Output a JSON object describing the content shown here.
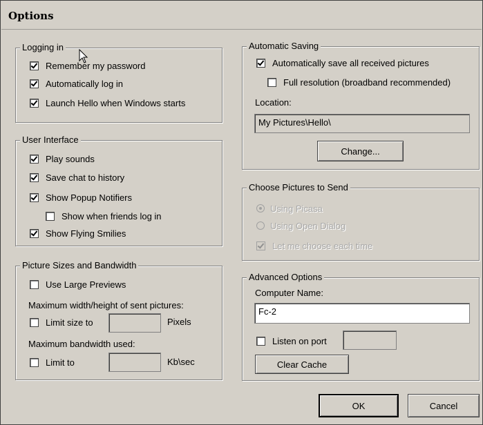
{
  "window": {
    "title": "Options"
  },
  "logging_in": {
    "legend": "Logging in",
    "remember_password": {
      "label": "Remember my password",
      "checked": true
    },
    "auto_login": {
      "label": "Automatically log in",
      "checked": true
    },
    "launch_on_start": {
      "label": "Launch Hello when Windows starts",
      "checked": true
    }
  },
  "user_interface": {
    "legend": "User Interface",
    "play_sounds": {
      "label": "Play sounds",
      "checked": true
    },
    "save_chat": {
      "label": "Save chat to history",
      "checked": true
    },
    "popup_notifiers": {
      "label": "Show Popup Notifiers",
      "checked": true
    },
    "friends_log_in": {
      "label": "Show when friends log in",
      "checked": false
    },
    "flying_smilies": {
      "label": "Show Flying Smilies",
      "checked": true
    }
  },
  "picture_sizes": {
    "legend": "Picture Sizes and Bandwidth",
    "large_previews": {
      "label": "Use Large Previews",
      "checked": false
    },
    "max_size_caption": "Maximum width/height of sent pictures:",
    "limit_size": {
      "label": "Limit size to",
      "checked": false,
      "value": "",
      "unit": "Pixels"
    },
    "max_bandwidth_caption": "Maximum bandwidth used:",
    "limit_bandwidth": {
      "label": "Limit to",
      "checked": false,
      "value": "",
      "unit": "Kb\\sec"
    }
  },
  "automatic_saving": {
    "legend": "Automatic Saving",
    "save_all": {
      "label": "Automatically save all received pictures",
      "checked": true
    },
    "full_resolution": {
      "label": "Full resolution (broadband recommended)",
      "checked": false
    },
    "location_label": "Location:",
    "location_value": "My Pictures\\Hello\\",
    "change_button": "Change..."
  },
  "choose_pictures": {
    "legend": "Choose Pictures to Send",
    "using_picasa": {
      "label": "Using Picasa",
      "selected": true
    },
    "using_open_dialog": {
      "label": "Using Open Dialog",
      "selected": false
    },
    "let_me_choose": {
      "label": "Let me choose each time",
      "checked": true
    }
  },
  "advanced": {
    "legend": "Advanced Options",
    "computer_name_label": "Computer Name:",
    "computer_name_value": "Fc-2",
    "listen_on_port": {
      "label": "Listen on port",
      "checked": false,
      "value": ""
    },
    "clear_cache_button": "Clear Cache"
  },
  "footer": {
    "ok_button": "OK",
    "cancel_button": "Cancel"
  }
}
